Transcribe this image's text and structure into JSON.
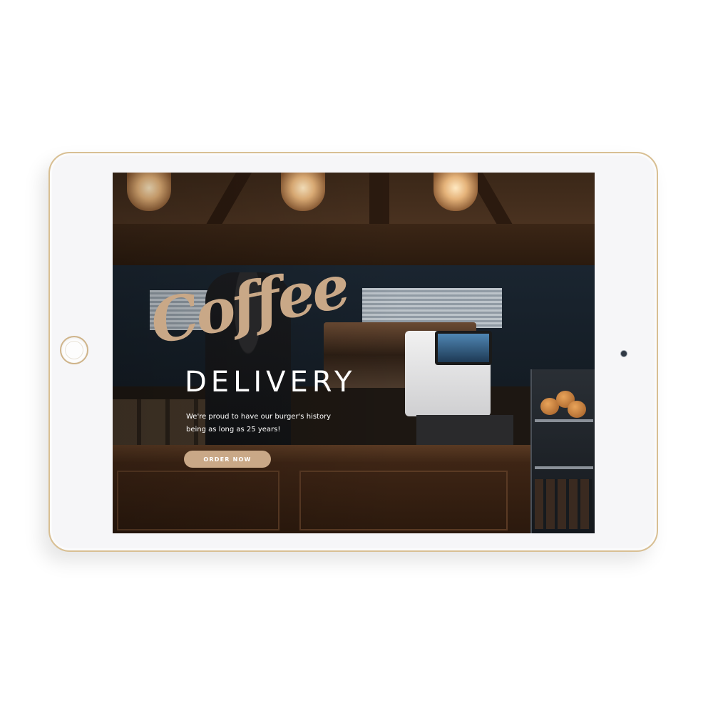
{
  "hero": {
    "script_word": "Coffee",
    "title": "DELIVERY",
    "description": "We're proud to have our burger's history being as long as 25 years!",
    "cta_label": "ORDER NOW"
  },
  "colors": {
    "accent": "#c9a887",
    "text": "#ffffff",
    "device_frame": "#d8bf93"
  },
  "icons": {
    "home_button": "home-button-icon",
    "camera": "camera-icon"
  }
}
